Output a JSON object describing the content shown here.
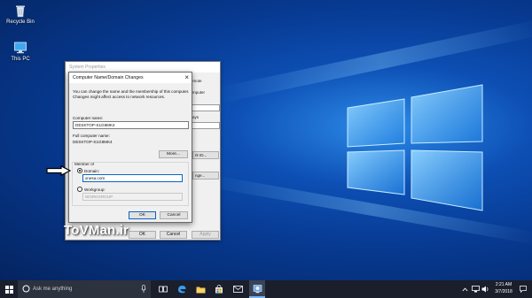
{
  "desktop": {
    "icons": [
      {
        "label": "Recycle Bin",
        "icon": "recycle-bin-icon"
      },
      {
        "label": "This PC",
        "icon": "computer-icon"
      }
    ],
    "watermark": "ToVMan.ir"
  },
  "system_properties": {
    "title": "System Properties",
    "fragments": {
      "tab_remote": "emote",
      "computer_label": "mputer",
      "ways_text": "ays",
      "network_id_button": "rk ID...",
      "change_button": "nge..."
    },
    "buttons": {
      "ok": "OK",
      "cancel": "Cancel",
      "apply": "Apply"
    }
  },
  "dialog": {
    "title": "Computer Name/Domain Changes",
    "description": "You can change the name and the membership of this computer. Changes might affect access to network resources.",
    "computer_name_label": "Computer name:",
    "computer_name_value": "DESKTOP-S1G8MK4",
    "full_name_label": "Full computer name:",
    "full_name_value": "DESKTOP-S1G8MK4",
    "more_button": "More...",
    "member_of_label": "Member of",
    "domain_label": "Domain:",
    "domain_value": "xnesa.com",
    "domain_selected": true,
    "workgroup_label": "Workgroup:",
    "workgroup_value": "WORKGROUP",
    "ok_button": "OK",
    "cancel_button": "Cancel"
  },
  "taskbar": {
    "search_placeholder": "Ask me anything",
    "time": "2:21 AM",
    "date": "3/7/2018",
    "apps": [
      "task-view-icon",
      "edge-icon",
      "file-explorer-icon",
      "store-icon",
      "mail-icon",
      "control-panel-icon"
    ]
  },
  "colors": {
    "accent": "#0a64c8",
    "taskbar": "#1a1f2b",
    "dialog_bg": "#f0f0f0"
  }
}
